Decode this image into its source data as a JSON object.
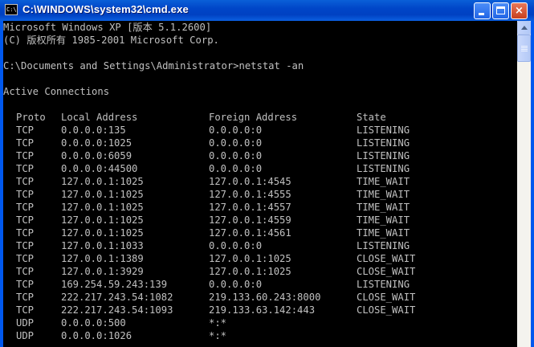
{
  "window": {
    "title": "C:\\WINDOWS\\system32\\cmd.exe",
    "icon_text": "C:\\",
    "colors": {
      "titlebar": "#0046c8",
      "console_bg": "#000000",
      "console_text": "#c0c0c0",
      "close_button": "#c8401e"
    },
    "buttons": {
      "minimize": "minimize-icon",
      "maximize": "maximize-icon",
      "close": "×"
    }
  },
  "console": {
    "header_lines": [
      "Microsoft Windows XP [版本 5.1.2600]",
      "(C) 版权所有 1985-2001 Microsoft Corp.",
      "",
      "C:\\Documents and Settings\\Administrator>netstat -an",
      "",
      "Active Connections",
      ""
    ],
    "table": {
      "headers": {
        "proto": "Proto",
        "local": "Local Address",
        "foreign": "Foreign Address",
        "state": "State"
      },
      "rows": [
        {
          "proto": "TCP",
          "local": "0.0.0.0:135",
          "foreign": "0.0.0.0:0",
          "state": "LISTENING"
        },
        {
          "proto": "TCP",
          "local": "0.0.0.0:1025",
          "foreign": "0.0.0.0:0",
          "state": "LISTENING"
        },
        {
          "proto": "TCP",
          "local": "0.0.0.0:6059",
          "foreign": "0.0.0.0:0",
          "state": "LISTENING"
        },
        {
          "proto": "TCP",
          "local": "0.0.0.0:44500",
          "foreign": "0.0.0.0:0",
          "state": "LISTENING"
        },
        {
          "proto": "TCP",
          "local": "127.0.0.1:1025",
          "foreign": "127.0.0.1:4545",
          "state": "TIME_WAIT"
        },
        {
          "proto": "TCP",
          "local": "127.0.0.1:1025",
          "foreign": "127.0.0.1:4555",
          "state": "TIME_WAIT"
        },
        {
          "proto": "TCP",
          "local": "127.0.0.1:1025",
          "foreign": "127.0.0.1:4557",
          "state": "TIME_WAIT"
        },
        {
          "proto": "TCP",
          "local": "127.0.0.1:1025",
          "foreign": "127.0.0.1:4559",
          "state": "TIME_WAIT"
        },
        {
          "proto": "TCP",
          "local": "127.0.0.1:1025",
          "foreign": "127.0.0.1:4561",
          "state": "TIME_WAIT"
        },
        {
          "proto": "TCP",
          "local": "127.0.0.1:1033",
          "foreign": "0.0.0.0:0",
          "state": "LISTENING"
        },
        {
          "proto": "TCP",
          "local": "127.0.0.1:1389",
          "foreign": "127.0.0.1:1025",
          "state": "CLOSE_WAIT"
        },
        {
          "proto": "TCP",
          "local": "127.0.0.1:3929",
          "foreign": "127.0.0.1:1025",
          "state": "CLOSE_WAIT"
        },
        {
          "proto": "TCP",
          "local": "169.254.59.243:139",
          "foreign": "0.0.0.0:0",
          "state": "LISTENING"
        },
        {
          "proto": "TCP",
          "local": "222.217.243.54:1082",
          "foreign": "219.133.60.243:8000",
          "state": "CLOSE_WAIT"
        },
        {
          "proto": "TCP",
          "local": "222.217.243.54:1093",
          "foreign": "219.133.63.142:443",
          "state": "CLOSE_WAIT"
        },
        {
          "proto": "UDP",
          "local": "0.0.0.0:500",
          "foreign": "*:*",
          "state": ""
        },
        {
          "proto": "UDP",
          "local": "0.0.0.0:1026",
          "foreign": "*:*",
          "state": ""
        }
      ]
    }
  },
  "scrollbar": {
    "up_arrow": "scroll-up-icon",
    "thumb": "scroll-thumb"
  }
}
